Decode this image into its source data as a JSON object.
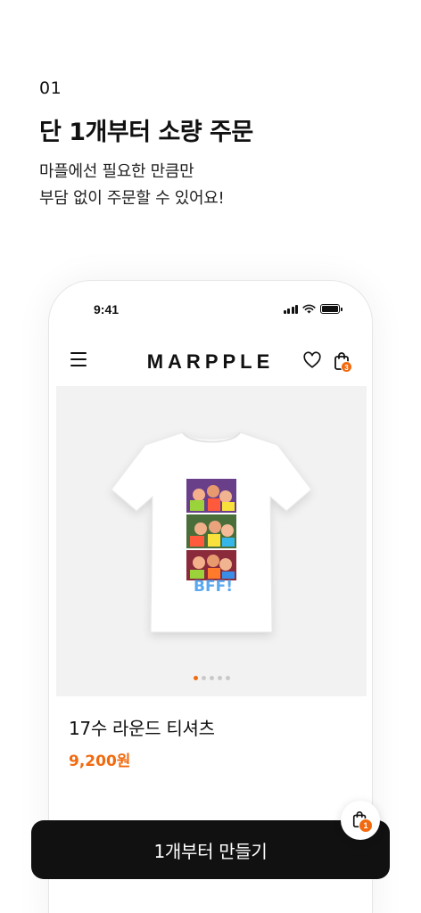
{
  "intro": {
    "step_number": "01",
    "headline": "단 1개부터 소량 주문",
    "subline_1": "마플에선 필요한 만큼만",
    "subline_2": "부담 없이 주문할 수 있어요!"
  },
  "phone": {
    "status_time": "9:41",
    "brand": "MARPPLE",
    "cart_count": "3",
    "product": {
      "name": "17수 라운드 티셔츠",
      "price": "9,200원",
      "print_text": "BFF!",
      "gallery_total": 5,
      "gallery_active_index": 0
    }
  },
  "cta": {
    "label": "1개부터 만들기"
  },
  "cart_fab": {
    "count": "1"
  },
  "colors": {
    "accent": "#f26a0f",
    "button_bg": "#111111",
    "image_bg": "#f2f2f2"
  },
  "icons": [
    "menu-icon",
    "heart-icon",
    "shopping-bag-icon",
    "signal-icon",
    "wifi-icon",
    "battery-icon"
  ]
}
